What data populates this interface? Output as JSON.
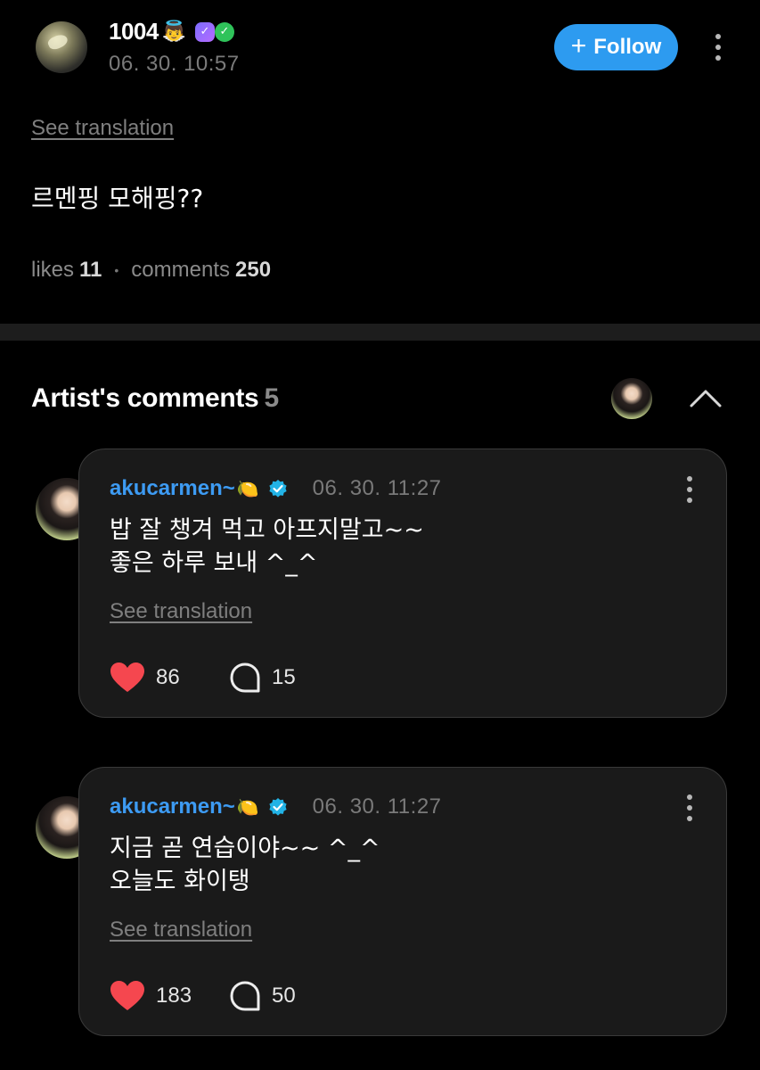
{
  "post": {
    "author": "1004",
    "author_emoji": "👼",
    "time": "06. 30. 10:57",
    "follow_label": "Follow",
    "see_translation": "See translation",
    "body": "르멘핑 모해핑??",
    "likes_label": "likes",
    "likes_count": "11",
    "comments_label": "comments",
    "comments_count": "250"
  },
  "artist_comments": {
    "title": "Artist's comments",
    "count": "5",
    "items": [
      {
        "name": "akucarmen~",
        "name_emoji": "🍋",
        "time": "06. 30. 11:27",
        "line1": "밥 잘 챙겨 먹고 아프지말고~~",
        "line2": "좋은 하루 보내 ^_^",
        "see_translation": "See translation",
        "likes": "86",
        "replies": "15"
      },
      {
        "name": "akucarmen~",
        "name_emoji": "🍋",
        "time": "06. 30. 11:27",
        "line1": "지금 곧 연습이야~~ ^_^",
        "line2": "오늘도 화이탱",
        "see_translation": "See translation",
        "likes": "183",
        "replies": "50"
      }
    ]
  },
  "colors": {
    "background": "#000000",
    "accent_blue": "#2d9bf0",
    "username_blue": "#3d9bf3",
    "heart_red": "#f5474f",
    "card_bg": "#1a1a1a"
  },
  "icons": [
    "author-avatar",
    "verified-badge-icon",
    "more-options-icon",
    "chevron-up-icon",
    "heart-icon",
    "comment-bubble-icon"
  ]
}
